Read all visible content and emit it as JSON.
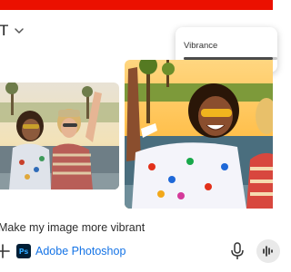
{
  "header": {
    "title_fragment": "T"
  },
  "vibrance_panel": {
    "label": "Vibrance",
    "level_fraction": 0.95
  },
  "prompt": {
    "text": "Make my image more vibrant"
  },
  "app_chip": {
    "icon_text": "Ps",
    "name": "Adobe Photoshop"
  },
  "colors": {
    "brand_red": "#eb1000",
    "link_blue": "#1473e6",
    "ps_icon_bg": "#001e36",
    "ps_icon_text": "#31a8ff"
  },
  "icons": [
    "chevron-down-icon",
    "plus-icon",
    "photoshop-icon",
    "microphone-icon",
    "audio-wave-icon"
  ]
}
